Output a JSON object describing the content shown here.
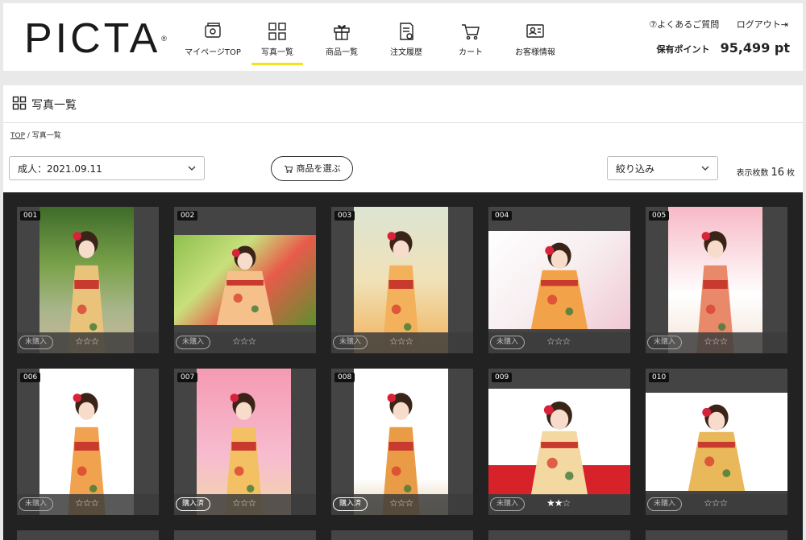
{
  "header": {
    "logo": "PICTA",
    "logo_mark": "®",
    "nav": [
      {
        "label": "マイページTOP",
        "icon": "photo-frame-icon",
        "active": false
      },
      {
        "label": "写真一覧",
        "icon": "photo-grid-icon",
        "active": true
      },
      {
        "label": "商品一覧",
        "icon": "gift-icon",
        "active": false
      },
      {
        "label": "注文履歴",
        "icon": "order-history-icon",
        "active": false
      },
      {
        "label": "カート",
        "icon": "cart-icon",
        "active": false
      },
      {
        "label": "お客様情報",
        "icon": "customer-info-icon",
        "active": false
      }
    ],
    "faq": "⑦よくあるご質問",
    "logout": "ログアウト⇥",
    "points_label": "保有ポイント",
    "points_value": "95,499 pt",
    "accent": "#f5e11e"
  },
  "page": {
    "title": "写真一覧",
    "breadcrumb": {
      "top": "TOP",
      "sep": " / ",
      "current": "写真一覧"
    }
  },
  "controls": {
    "album_select": "成人：2021.09.11",
    "product_button": "商品を選ぶ",
    "filter_select": "絞り込み",
    "count_label": "表示枚数",
    "count_value": "16",
    "count_unit": "枚"
  },
  "photos": [
    {
      "num": "001",
      "status": "未購入",
      "rating": 0,
      "max": 3
    },
    {
      "num": "002",
      "status": "未購入",
      "rating": 0,
      "max": 3
    },
    {
      "num": "003",
      "status": "未購入",
      "rating": 0,
      "max": 3
    },
    {
      "num": "004",
      "status": "未購入",
      "rating": 0,
      "max": 3
    },
    {
      "num": "005",
      "status": "未購入",
      "rating": 0,
      "max": 3
    },
    {
      "num": "006",
      "status": "未購入",
      "rating": 0,
      "max": 3
    },
    {
      "num": "007",
      "status": "購入済",
      "rating": 0,
      "max": 3
    },
    {
      "num": "008",
      "status": "購入済",
      "rating": 0,
      "max": 3
    },
    {
      "num": "009",
      "status": "未購入",
      "rating": 2,
      "max": 3
    },
    {
      "num": "010",
      "status": "未購入",
      "rating": 0,
      "max": 3
    }
  ]
}
